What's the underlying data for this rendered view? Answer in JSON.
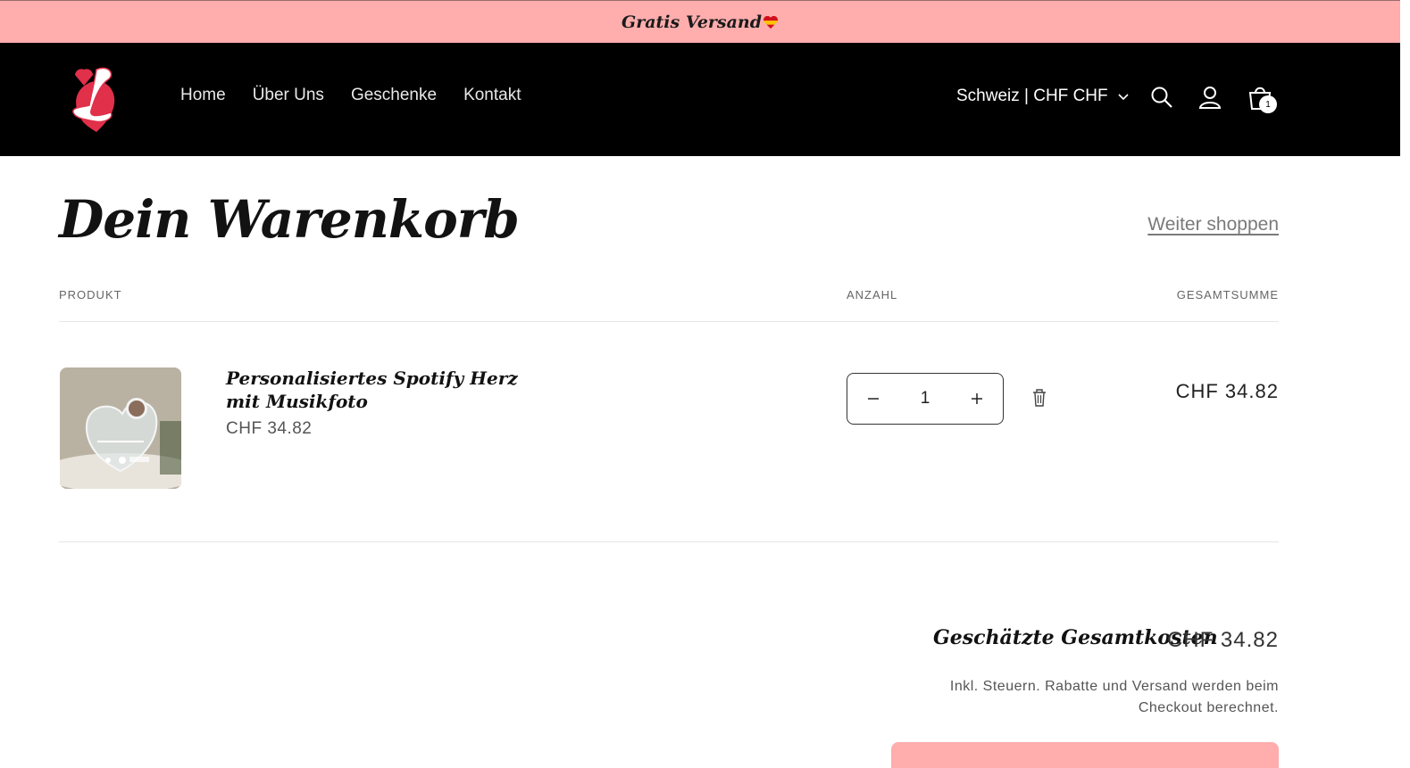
{
  "announcement": {
    "text": "Gratis Versand"
  },
  "header": {
    "nav": [
      "Home",
      "Über Uns",
      "Geschenke",
      "Kontakt"
    ],
    "localization": "Schweiz | CHF CHF",
    "cart_count": "1"
  },
  "cart": {
    "title": "Dein Warenkorb",
    "continue_link": "Weiter shoppen",
    "columns": {
      "product": "PRODUKT",
      "quantity": "ANZAHL",
      "total": "GESAMTSUMME"
    },
    "item": {
      "name": "Personalisiertes Spotify Herz mit Musikfoto",
      "price": "CHF 34.82",
      "quantity": "1",
      "line_total": "CHF 34.82"
    },
    "summary": {
      "label": "Geschätzte Gesamtkosten",
      "value": "CHF 34.82",
      "note": "Inkl. Steuern. Rabatte und Versand werden beim Checkout berechnet."
    }
  },
  "colors": {
    "announcement_bg": "#ffadad",
    "header_bg": "#000000",
    "logo_red": "#e0304a"
  }
}
